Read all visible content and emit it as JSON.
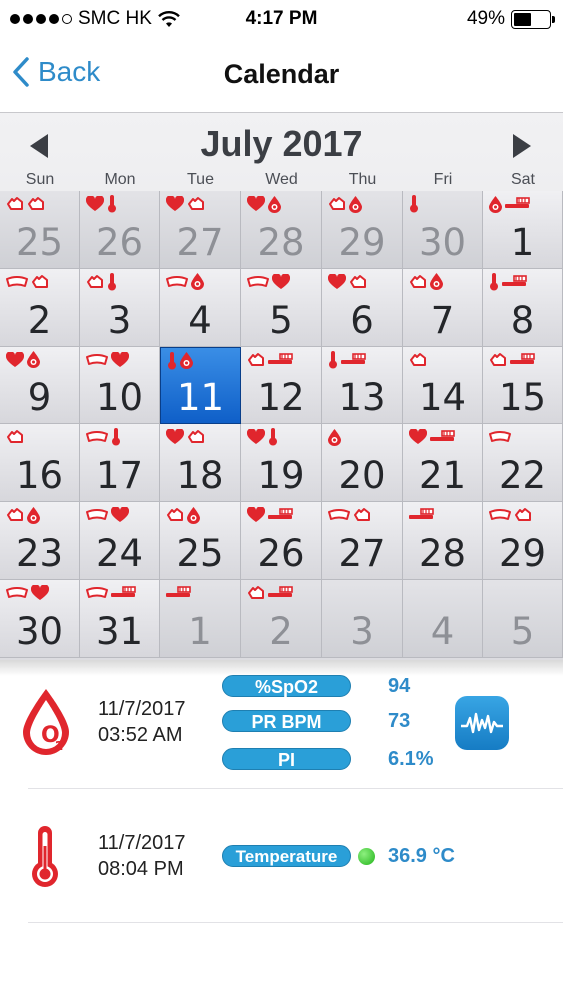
{
  "status_bar": {
    "carrier": "SMC HK",
    "time": "4:17 PM",
    "battery": "49%",
    "battery_level": 0.49,
    "signal_bars_filled": 4,
    "signal_bars_total": 5
  },
  "nav": {
    "back_label": "Back",
    "title": "Calendar"
  },
  "calendar": {
    "month_title": "July 2017",
    "weekdays": [
      "Sun",
      "Mon",
      "Tue",
      "Wed",
      "Thu",
      "Fri",
      "Sat"
    ],
    "selected_day": "11",
    "icon_colors": {
      "red": "#e0262d",
      "white": "#ffffff"
    },
    "days": [
      {
        "day": "25",
        "other": true,
        "icons": [
          "hand",
          "hand"
        ]
      },
      {
        "day": "26",
        "other": true,
        "icons": [
          "heart",
          "thermo"
        ]
      },
      {
        "day": "27",
        "other": true,
        "icons": [
          "heart",
          "hand"
        ]
      },
      {
        "day": "28",
        "other": true,
        "icons": [
          "heart",
          "drop"
        ]
      },
      {
        "day": "29",
        "other": true,
        "icons": [
          "hand",
          "drop"
        ]
      },
      {
        "day": "30",
        "other": true,
        "icons": [
          "thermo"
        ]
      },
      {
        "day": "1",
        "other": false,
        "icons": [
          "drop",
          "brush"
        ]
      },
      {
        "day": "2",
        "other": false,
        "icons": [
          "cuff",
          "hand"
        ]
      },
      {
        "day": "3",
        "other": false,
        "icons": [
          "hand",
          "thermo"
        ]
      },
      {
        "day": "4",
        "other": false,
        "icons": [
          "cuff",
          "drop"
        ]
      },
      {
        "day": "5",
        "other": false,
        "icons": [
          "cuff",
          "heart"
        ]
      },
      {
        "day": "6",
        "other": false,
        "icons": [
          "heart",
          "hand"
        ]
      },
      {
        "day": "7",
        "other": false,
        "icons": [
          "hand",
          "drop"
        ]
      },
      {
        "day": "8",
        "other": false,
        "icons": [
          "thermo",
          "brush"
        ]
      },
      {
        "day": "9",
        "other": false,
        "icons": [
          "heart",
          "drop"
        ]
      },
      {
        "day": "10",
        "other": false,
        "icons": [
          "cuff",
          "heart"
        ]
      },
      {
        "day": "11",
        "other": false,
        "icons": [
          "thermo",
          "drop"
        ],
        "selected": true
      },
      {
        "day": "12",
        "other": false,
        "icons": [
          "hand",
          "brush"
        ]
      },
      {
        "day": "13",
        "other": false,
        "icons": [
          "thermo",
          "brush"
        ]
      },
      {
        "day": "14",
        "other": false,
        "icons": [
          "hand"
        ]
      },
      {
        "day": "15",
        "other": false,
        "icons": [
          "hand",
          "brush"
        ]
      },
      {
        "day": "16",
        "other": false,
        "icons": [
          "hand"
        ]
      },
      {
        "day": "17",
        "other": false,
        "icons": [
          "cuff",
          "thermo"
        ]
      },
      {
        "day": "18",
        "other": false,
        "icons": [
          "heart",
          "hand"
        ]
      },
      {
        "day": "19",
        "other": false,
        "icons": [
          "heart",
          "thermo"
        ]
      },
      {
        "day": "20",
        "other": false,
        "icons": [
          "drop"
        ]
      },
      {
        "day": "21",
        "other": false,
        "icons": [
          "heart",
          "brush"
        ]
      },
      {
        "day": "22",
        "other": false,
        "icons": [
          "cuff"
        ]
      },
      {
        "day": "23",
        "other": false,
        "icons": [
          "hand",
          "drop"
        ]
      },
      {
        "day": "24",
        "other": false,
        "icons": [
          "cuff",
          "heart"
        ]
      },
      {
        "day": "25",
        "other": false,
        "icons": [
          "hand",
          "drop"
        ]
      },
      {
        "day": "26",
        "other": false,
        "icons": [
          "heart",
          "brush"
        ]
      },
      {
        "day": "27",
        "other": false,
        "icons": [
          "cuff",
          "hand"
        ]
      },
      {
        "day": "28",
        "other": false,
        "icons": [
          "brush"
        ]
      },
      {
        "day": "29",
        "other": false,
        "icons": [
          "cuff",
          "hand"
        ]
      },
      {
        "day": "30",
        "other": false,
        "icons": [
          "cuff",
          "heart"
        ]
      },
      {
        "day": "31",
        "other": false,
        "icons": [
          "cuff",
          "brush"
        ]
      },
      {
        "day": "1",
        "other": true,
        "icons": [
          "brush"
        ]
      },
      {
        "day": "2",
        "other": true,
        "icons": [
          "hand",
          "brush"
        ]
      },
      {
        "day": "3",
        "other": true,
        "icons": []
      },
      {
        "day": "4",
        "other": true,
        "icons": []
      },
      {
        "day": "5",
        "other": true,
        "icons": []
      }
    ]
  },
  "records": [
    {
      "icon": "o2-drop-icon",
      "date": "11/7/2017",
      "time": "03:52 AM",
      "metrics": [
        {
          "label": "%SpO2",
          "value": "94"
        },
        {
          "label": "PR BPM",
          "value": "73"
        },
        {
          "label": "PI",
          "value": "6.1%"
        }
      ],
      "action_icon": "pulse-wave-icon"
    },
    {
      "icon": "thermometer-icon",
      "date": "11/7/2017",
      "time": "08:04 PM",
      "metrics": [
        {
          "label": "Temperature",
          "value": "36.9 °C",
          "status_color": "#22b31a"
        }
      ]
    }
  ]
}
